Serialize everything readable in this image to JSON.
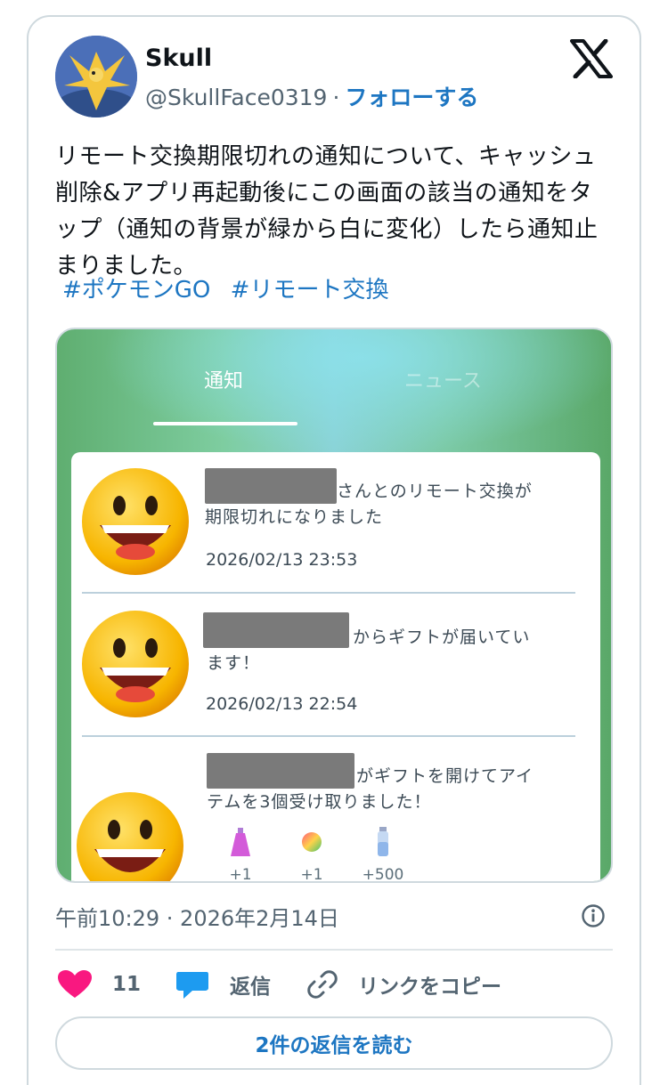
{
  "author": {
    "name": "Skull",
    "handle": "@SkullFace0319",
    "separator": "·",
    "follow_label": "フォローする"
  },
  "tweet": {
    "text": "リモート交換期限切れの通知について、キャッシュ削除&アプリ再起動後にこの画面の該当の通知をタップ（通知の背景が緑から白に変化）したら通知止まりました。",
    "hashtags": [
      "#ポケモンGO",
      "#リモート交換"
    ]
  },
  "screenshot": {
    "tabs": [
      "通知",
      "ニュース"
    ],
    "notifications": [
      {
        "line1": "さんとのリモート交換が",
        "line2": "期限切れになりました",
        "date": "2026/02/13 23:53"
      },
      {
        "line1": "からギフトが届いてい",
        "line2": "ます！",
        "date": "2026/02/13 22:54"
      },
      {
        "line1": "がギフトを開けてアイ",
        "line2": "テムを3個受け取りました！",
        "items": [
          {
            "icon": "pink-incense-icon",
            "label": "+1"
          },
          {
            "icon": "rainbow-ball-icon",
            "label": "+1"
          },
          {
            "icon": "potion-icon",
            "label": "+500"
          }
        ]
      }
    ]
  },
  "meta": {
    "timestamp": "午前10:29 · 2026年2月14日"
  },
  "actions": {
    "like_count": "11",
    "reply_label": "返信",
    "copy_label": "リンクをコピー"
  },
  "read_replies_label": "2件の返信を読む",
  "colors": {
    "link": "#1d76c2",
    "like": "#f91880",
    "reply": "#1d9bf0"
  }
}
